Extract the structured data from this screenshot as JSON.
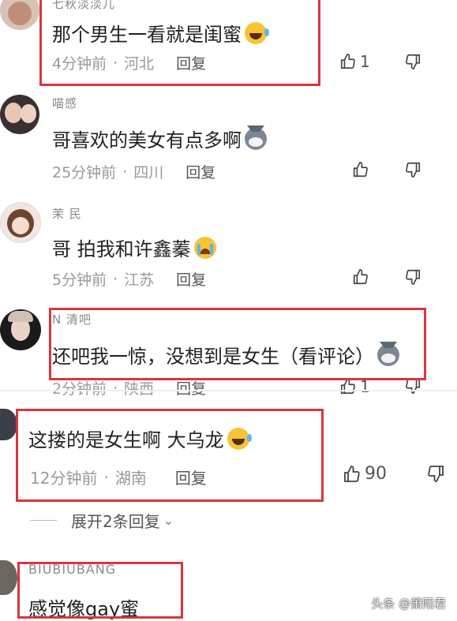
{
  "comments": [
    {
      "username": "七秋淡淡儿",
      "text": "那个男生一看就是闺蜜",
      "emoji": "laugh-cry-emoji",
      "time": "4分钟前",
      "location": "河北",
      "reply_label": "回复",
      "likes": "1"
    },
    {
      "username": "喵感",
      "text": "哥喜欢的美女有点多啊",
      "emoji": "husky-dog-emoji",
      "time": "25分钟前",
      "location": "四川",
      "reply_label": "回复",
      "likes": ""
    },
    {
      "username": "茉 民",
      "text": "哥 拍我和许鑫蓁",
      "emoji": "crying-emoji",
      "time": "5分钟前",
      "location": "江苏",
      "reply_label": "回复",
      "likes": ""
    },
    {
      "username": "N 清吧",
      "text": "还吧我一惊，没想到是女生（看评论）",
      "emoji": "husky-dog-emoji",
      "time": "2分钟前",
      "location": "陕西",
      "reply_label": "回复",
      "likes": "1"
    },
    {
      "username": "",
      "text": "这搂的是女生啊 大乌龙",
      "emoji": "laugh-cry-emoji",
      "time": "12分钟前",
      "location": "湖南",
      "reply_label": "回复",
      "likes": "90"
    },
    {
      "username": "BIUBIUBANG",
      "text": "感觉像gay蜜",
      "emoji": "",
      "time": "",
      "location": "",
      "reply_label": "",
      "likes": ""
    }
  ],
  "expand_replies": "展开2条回复",
  "watermark": "头条 @萧陌君",
  "colors": {
    "highlight_box": "#d9363e",
    "meta_text": "#999999",
    "main_text": "#222222"
  },
  "icons": {
    "like": "thumbs-up-icon",
    "dislike": "thumbs-down-icon",
    "expand": "chevron-down-icon"
  }
}
